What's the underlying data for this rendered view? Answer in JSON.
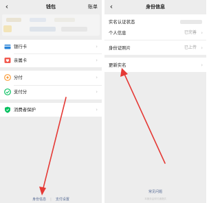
{
  "colors": {
    "accent_red": "#e53935",
    "link_blue": "#576b95",
    "wechat_green": "#07c160",
    "orange": "#fa9d3b",
    "blue": "#2782d7"
  },
  "wallet": {
    "title": "钱包",
    "right_action": "账单",
    "back_icon": "chevron-left-icon",
    "menu": [
      {
        "label": "银行卡",
        "icon": "bank-card-icon"
      },
      {
        "label": "亲属卡",
        "icon": "family-card-icon"
      },
      {
        "label": "分付",
        "icon": "fenfu-icon"
      },
      {
        "label": "支付分",
        "icon": "payscore-icon"
      },
      {
        "label": "消费者保护",
        "icon": "shield-icon"
      }
    ],
    "footer": {
      "identity": "身份信息",
      "pay_settings": "支付设置"
    }
  },
  "identity": {
    "title": "身份信息",
    "rows": [
      {
        "label": "实名认证状态",
        "value": ""
      },
      {
        "label": "个人信息",
        "value": "已完善"
      },
      {
        "label": "身份证照片",
        "value": "已上传"
      },
      {
        "label": "更新实名",
        "value": ""
      }
    ],
    "faq": "常见问题",
    "fine_print": "本服务由财付通提供"
  }
}
